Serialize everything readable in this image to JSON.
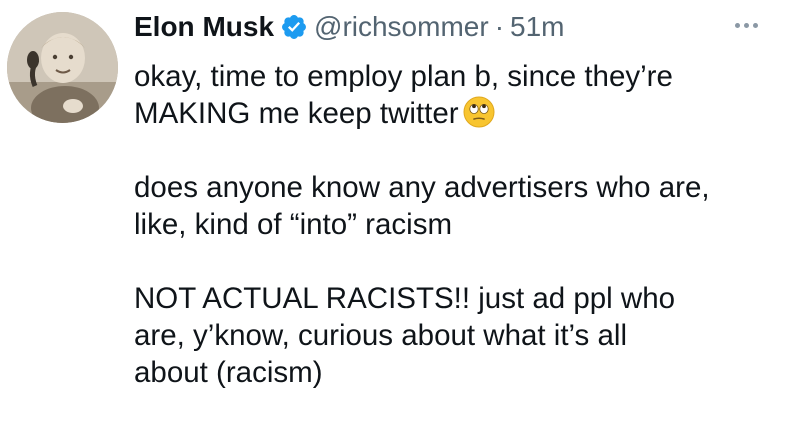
{
  "tweet": {
    "author_name": "Elon Musk",
    "handle": "@richsommer",
    "separator": "·",
    "timestamp": "51m",
    "verified_icon": "verified-badge-icon",
    "more_icon": "more-horizontal-icon",
    "paragraphs": [
      {
        "lines": [
          "okay, time to employ plan b, since they’re",
          "MAKING me keep twitter"
        ],
        "emoji": "face-with-rolling-eyes"
      },
      {
        "lines": [
          "does anyone know any advertisers who are,",
          "like, kind of “into” racism"
        ]
      },
      {
        "lines": [
          "NOT ACTUAL RACISTS!! just ad ppl who",
          "are, y’know, curious about what it’s all",
          "about (racism)"
        ]
      }
    ]
  },
  "colors": {
    "text": "#0f1419",
    "secondary": "#536471",
    "verified": "#1d9bf0",
    "background": "#ffffff"
  }
}
